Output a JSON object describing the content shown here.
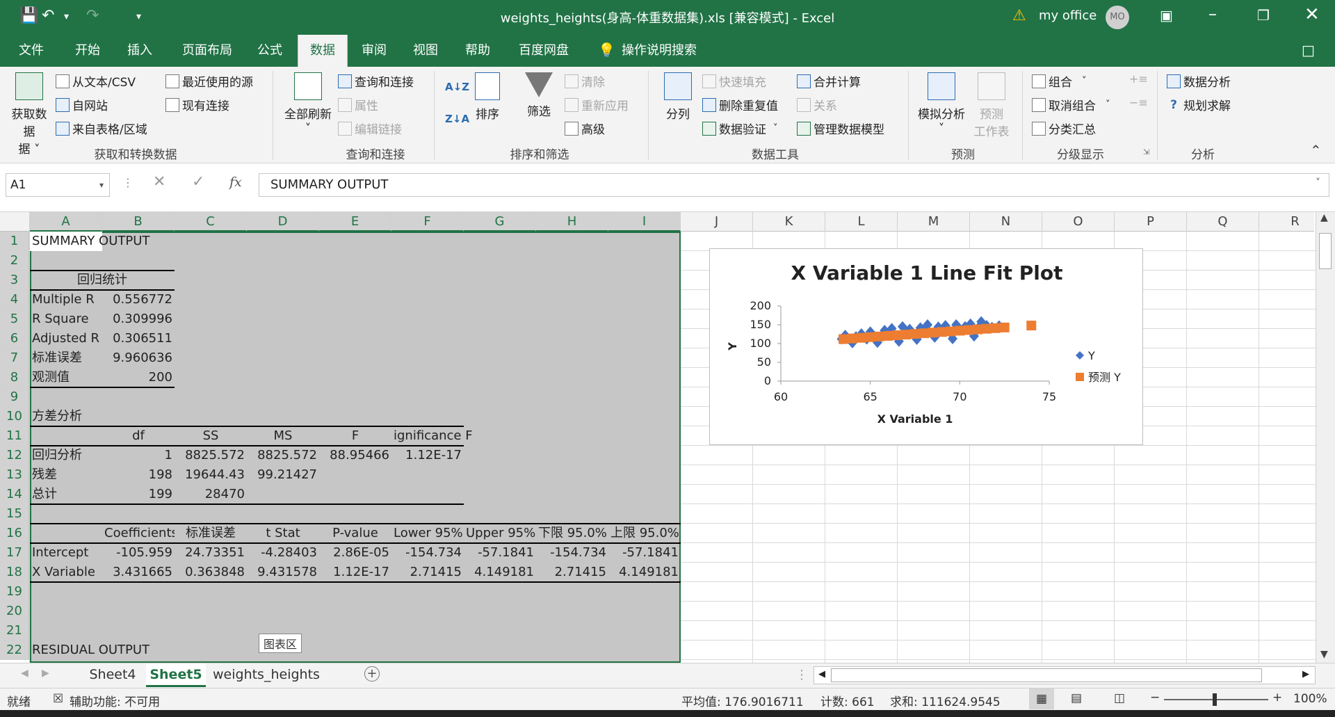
{
  "title_bar": {
    "doc_title": "weights_heights(身高-体重数据集).xls  [兼容模式]  -  Excel",
    "user": "my office",
    "avatar": "MO"
  },
  "tabs": [
    "文件",
    "开始",
    "插入",
    "页面布局",
    "公式",
    "数据",
    "审阅",
    "视图",
    "帮助",
    "百度网盘",
    "操作说明搜索"
  ],
  "ribbon": {
    "get_data": "获取数据",
    "get_data2": "据",
    "from_text": "从文本/CSV",
    "from_web": "自网站",
    "from_table": "来自表格/区域",
    "recent": "最近使用的源",
    "existing": "现有连接",
    "grp1": "获取和转换数据",
    "refresh_all": "全部刷新",
    "queries": "查询和连接",
    "properties": "属性",
    "edit_links": "编辑链接",
    "grp2": "查询和连接",
    "sort": "排序",
    "filter": "筛选",
    "clear": "清除",
    "reapply": "重新应用",
    "advanced": "高级",
    "grp3": "排序和筛选",
    "split": "分列",
    "flash_fill": "快速填充",
    "remove_dup": "删除重复值",
    "validation": "数据验证",
    "consolidate": "合并计算",
    "relations": "关系",
    "data_model": "管理数据模型",
    "grp4": "数据工具",
    "whatif": "模拟分析",
    "forecast": "预测",
    "forecast2": "工作表",
    "grp5": "预测",
    "group": "组合",
    "ungroup": "取消组合",
    "subtotal": "分类汇总",
    "grp6": "分级显示",
    "analysis": "数据分析",
    "solver": "规划求解",
    "grp7": "分析"
  },
  "formula_bar": {
    "name_box": "A1",
    "fx": "fx",
    "content": "SUMMARY OUTPUT"
  },
  "columns": [
    "A",
    "B",
    "C",
    "D",
    "E",
    "F",
    "G",
    "H",
    "I",
    "J",
    "K",
    "L",
    "M",
    "N",
    "O",
    "P",
    "Q",
    "R"
  ],
  "rows": [
    "1",
    "2",
    "3",
    "4",
    "5",
    "6",
    "7",
    "8",
    "9",
    "10",
    "11",
    "12",
    "13",
    "14",
    "15",
    "16",
    "17",
    "18",
    "19",
    "20",
    "21",
    "22"
  ],
  "cells": {
    "a1": "SUMMARY OUTPUT",
    "a3": "回归统计",
    "a4": "Multiple R",
    "b4": "0.556772",
    "a5": "R Square",
    "b5": "0.309996",
    "a6": "Adjusted R",
    "b6": "0.306511",
    "a7": "标准误差",
    "b7": "9.960636",
    "a8": "观测值",
    "b8": "200",
    "a10": "方差分析",
    "b11": "df",
    "c11": "SS",
    "d11": "MS",
    "e11": "F",
    "f11": "ignificance F",
    "a12": "回归分析",
    "b12": "1",
    "c12": "8825.572",
    "d12": "8825.572",
    "e12": "88.95466",
    "f12": "1.12E-17",
    "a13": "残差",
    "b13": "198",
    "c13": "19644.43",
    "d13": "99.21427",
    "a14": "总计",
    "b14": "199",
    "c14": "28470",
    "b16": "Coefficients",
    "c16": "标准误差",
    "d16": "t Stat",
    "e16": "P-value",
    "f16": "Lower 95%",
    "g16": "Upper 95%",
    "h16": "下限 95.0%",
    "i16": "上限 95.0%",
    "a17": "Intercept",
    "b17": "-105.959",
    "c17": "24.73351",
    "d17": "-4.28403",
    "e17": "2.86E-05",
    "f17": "-154.734",
    "g17": "-57.1841",
    "h17": "-154.734",
    "i17": "-57.1841",
    "a18": "X Variable",
    "b18": "3.431665",
    "c18": "0.363848",
    "d18": "9.431578",
    "e18": "1.12E-17",
    "f18": "2.71415",
    "g18": "4.149181",
    "h18": "2.71415",
    "i18": "4.149181",
    "a22": "RESIDUAL OUTPUT"
  },
  "chart_tooltip": "图表区",
  "sheets": [
    "Sheet4",
    "Sheet5",
    "weights_heights"
  ],
  "status": {
    "ready": "就绪",
    "accessibility": "辅助功能: 不可用",
    "average": "平均值: 176.9016711",
    "count": "计数: 661",
    "sum": "求和: 111624.9545",
    "zoom": "100%"
  },
  "chart_data": {
    "type": "scatter",
    "title": "X Variable 1 Line Fit  Plot",
    "xlabel": "X Variable 1",
    "ylabel": "Y",
    "xlim": [
      60,
      75
    ],
    "ylim": [
      0,
      200
    ],
    "xticks": [
      "60",
      "65",
      "70",
      "75"
    ],
    "yticks": [
      "0",
      "50",
      "100",
      "150",
      "200"
    ],
    "legend_position": "right",
    "series": [
      {
        "name": "Y",
        "color": "#4472c4",
        "marker": "diamond",
        "x": [
          63.4,
          63.6,
          63.9,
          64.2,
          64.5,
          64.8,
          65.0,
          65.2,
          65.5,
          65.8,
          66.0,
          66.2,
          66.5,
          66.8,
          67.0,
          67.2,
          67.5,
          67.8,
          68.0,
          68.2,
          68.5,
          68.8,
          69.0,
          69.2,
          69.5,
          69.8,
          70.0,
          70.3,
          70.6,
          71.0,
          71.2,
          71.5,
          71.8,
          72.2,
          64.0,
          65.4,
          66.6,
          67.6,
          68.6,
          69.6,
          70.8
        ],
        "y": [
          112,
          122,
          108,
          118,
          126,
          112,
          131,
          120,
          115,
          135,
          125,
          140,
          118,
          145,
          128,
          138,
          122,
          142,
          132,
          150,
          125,
          144,
          135,
          148,
          128,
          150,
          138,
          145,
          152,
          140,
          158,
          148,
          143,
          147,
          102,
          103,
          106,
          111,
          117,
          113,
          120
        ]
      },
      {
        "name": "预测 Y",
        "color": "#ed7d31",
        "marker": "square",
        "x": [
          63.5,
          64.0,
          64.5,
          65.0,
          65.5,
          66.0,
          66.5,
          67.0,
          67.5,
          68.0,
          68.5,
          69.0,
          69.5,
          70.0,
          70.5,
          71.0,
          71.5,
          72.0,
          72.5,
          74.0
        ],
        "y": [
          111.9,
          113.6,
          115.3,
          117.1,
          118.8,
          120.5,
          122.2,
          123.9,
          125.7,
          127.4,
          129.1,
          130.8,
          132.5,
          134.3,
          136.0,
          137.7,
          139.4,
          141.1,
          142.8,
          148.0
        ]
      }
    ]
  }
}
